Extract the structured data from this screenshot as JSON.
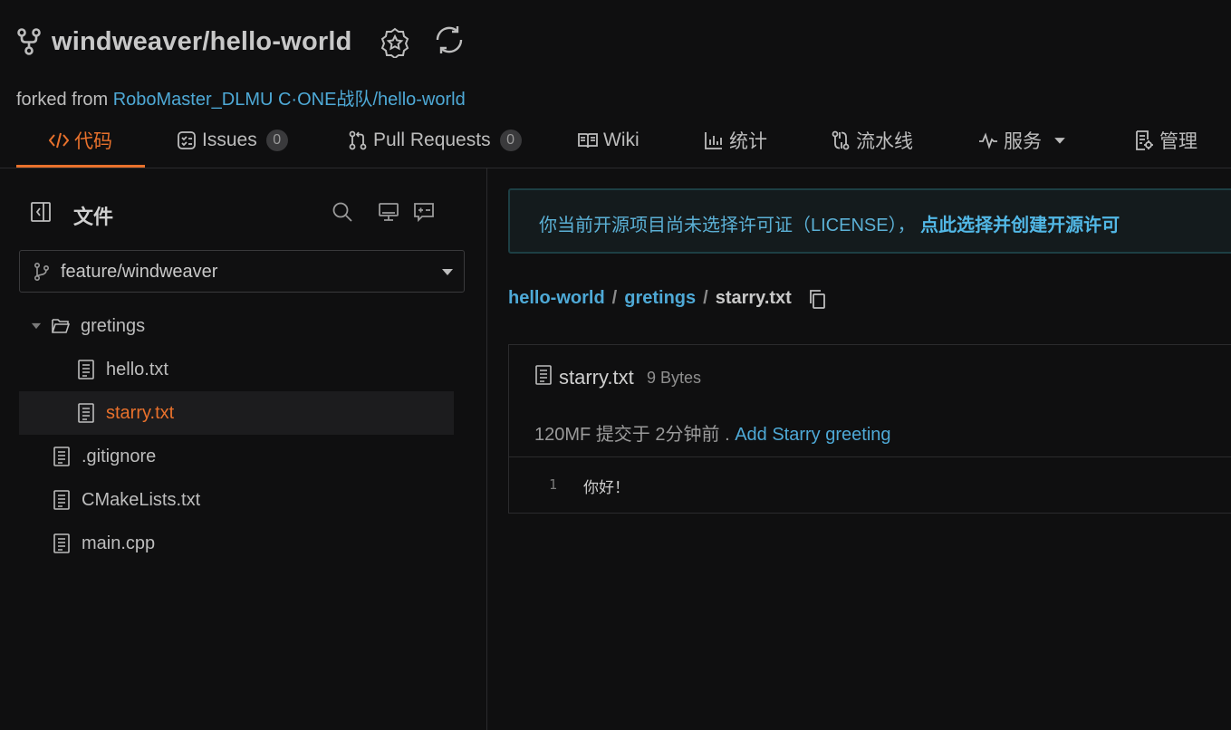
{
  "header": {
    "repo_title": "windweaver/hello-world",
    "forked_from_prefix": "forked from ",
    "forked_from_org": "RoboMaster_DLMU C·ONE战队",
    "forked_from_sep": "/",
    "forked_from_repo": "hello-world"
  },
  "tabs": [
    {
      "label": "代码",
      "icon": "code-icon",
      "active": true
    },
    {
      "label": "Issues",
      "icon": "issues-icon",
      "count": "0"
    },
    {
      "label": "Pull Requests",
      "icon": "pull-request-icon",
      "count": "0"
    },
    {
      "label": "Wiki",
      "icon": "book-icon"
    },
    {
      "label": "统计",
      "icon": "bar-chart-icon"
    },
    {
      "label": "流水线",
      "icon": "pipeline-icon"
    },
    {
      "label": "服务",
      "icon": "pulse-icon",
      "has_dropdown": true
    },
    {
      "label": "管理",
      "icon": "settings-doc-icon"
    }
  ],
  "sidebar": {
    "title": "文件",
    "branch": "feature/windweaver",
    "tree": [
      {
        "name": "gretings",
        "type": "folder",
        "expanded": true
      },
      {
        "name": "hello.txt",
        "type": "file"
      },
      {
        "name": "starry.txt",
        "type": "file",
        "selected": true
      },
      {
        "name": ".gitignore",
        "type": "file"
      },
      {
        "name": "CMakeLists.txt",
        "type": "file"
      },
      {
        "name": "main.cpp",
        "type": "file"
      }
    ]
  },
  "main": {
    "license_text": "你当前开源项目尚未选择许可证（LICENSE），",
    "license_link": "点此选择并创建开源许可",
    "breadcrumb": {
      "root": "hello-world",
      "sep1": "/",
      "folder": "gretings",
      "sep2": "/",
      "file": "starry.txt"
    },
    "file": {
      "name": "starry.txt",
      "size": "9 Bytes",
      "commit_author": "120MF",
      "commit_action": "提交于",
      "commit_time": "2分钟前",
      "commit_sep": ".",
      "commit_message": "Add Starry greeting",
      "lines": [
        {
          "number": "1",
          "content": "你好！"
        }
      ]
    }
  },
  "colors": {
    "accent": "#e8712c",
    "link": "#4ea9d6",
    "background": "#0f0f10"
  }
}
